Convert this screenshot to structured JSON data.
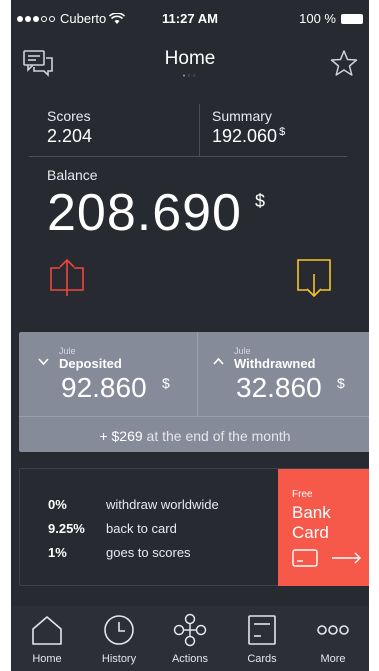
{
  "status_bar": {
    "carrier": "Cuberto",
    "time": "11:27 AM",
    "battery": "100 %"
  },
  "header": {
    "title": "Home",
    "page_indicator": "●○○"
  },
  "scores": {
    "label": "Scores",
    "value": "2.204"
  },
  "summary": {
    "label": "Summary",
    "value": "192.060",
    "currency": "$"
  },
  "balance": {
    "label": "Balance",
    "value": "208.690",
    "currency": "$"
  },
  "deposited": {
    "month": "Jule",
    "label": "Deposited",
    "value": "92.860",
    "currency": "$"
  },
  "withdrawned": {
    "month": "Jule",
    "label": "Withdrawned",
    "value": "32.860",
    "currency": "$"
  },
  "forecast": {
    "amount": "+ $269",
    "text": " at the end of the month"
  },
  "offer": {
    "rows": [
      {
        "pct": "0%",
        "text": "withdraw worldwide"
      },
      {
        "pct": "9.25%",
        "text": "back to card"
      },
      {
        "pct": "1%",
        "text": "goes to scores"
      }
    ],
    "badge": "Free",
    "title": "Bank Card"
  },
  "tabs": [
    {
      "label": "Home",
      "icon": "home-icon"
    },
    {
      "label": "History",
      "icon": "clock-icon"
    },
    {
      "label": "Actions",
      "icon": "actions-icon"
    },
    {
      "label": "Cards",
      "icon": "card-icon"
    },
    {
      "label": "More",
      "icon": "more-icon"
    }
  ],
  "colors": {
    "background": "#272a31",
    "panel": "#858b98",
    "upload_accent": "#f0463b",
    "download_accent": "#f7c32c",
    "bank_card": "#f6584a"
  }
}
